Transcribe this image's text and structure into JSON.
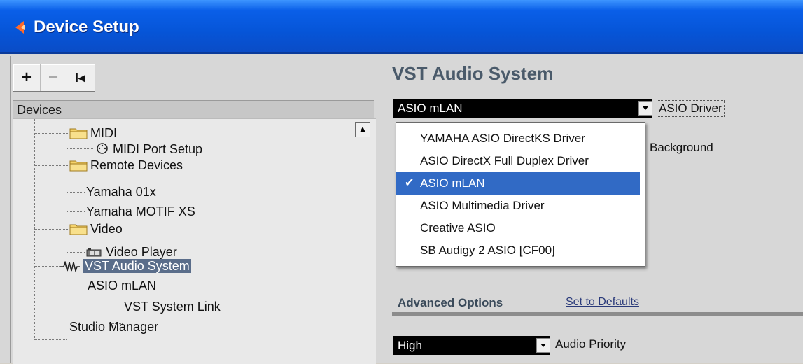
{
  "window": {
    "title": "Device Setup"
  },
  "toolbar": {
    "add": "+",
    "remove": "−",
    "reset": "I◂"
  },
  "devices": {
    "header": "Devices",
    "tree": [
      {
        "label": "MIDI"
      },
      {
        "label": "MIDI Port Setup"
      },
      {
        "label": "Remote Devices"
      },
      {
        "label": "Yamaha 01x"
      },
      {
        "label": "Yamaha MOTIF XS"
      },
      {
        "label": "Video"
      },
      {
        "label": "Video Player"
      },
      {
        "label": "VST Audio System"
      },
      {
        "label": "ASIO mLAN"
      },
      {
        "label": "VST System Link"
      },
      {
        "label": "Studio Manager"
      }
    ]
  },
  "panel": {
    "title": "VST Audio System",
    "driver_value": "ASIO mLAN",
    "driver_label": "ASIO Driver",
    "background_label": "Background",
    "dropdown": [
      {
        "label": "YAMAHA ASIO DirectKS Driver"
      },
      {
        "label": "ASIO DirectX Full Duplex Driver"
      },
      {
        "label": "ASIO mLAN",
        "checked": "✔"
      },
      {
        "label": "ASIO Multimedia Driver"
      },
      {
        "label": "Creative ASIO"
      },
      {
        "label": "SB Audigy 2 ASIO [CF00]"
      }
    ],
    "advanced_options": "Advanced Options",
    "set_to_defaults": "Set to Defaults",
    "priority_value": "High",
    "priority_label": "Audio Priority"
  }
}
